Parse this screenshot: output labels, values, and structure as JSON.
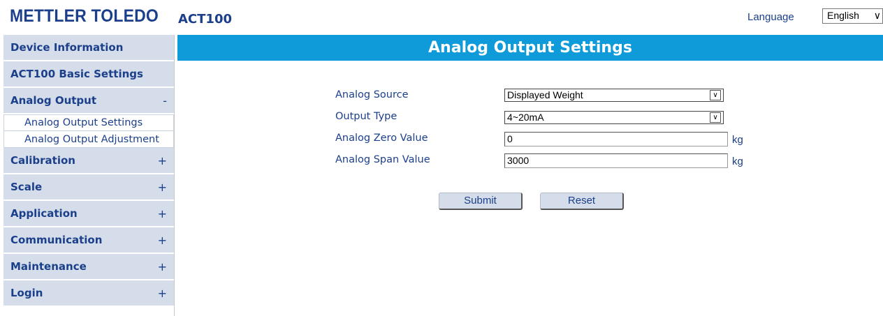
{
  "header": {
    "brand": "METTLER TOLEDO",
    "model": "ACT100",
    "language_label": "Language",
    "language_value": "English"
  },
  "sidebar": {
    "items": [
      {
        "label": "Device Information",
        "toggle": ""
      },
      {
        "label": "ACT100 Basic Settings",
        "toggle": ""
      },
      {
        "label": "Analog Output",
        "toggle": "-"
      },
      {
        "label": "Calibration",
        "toggle": "+"
      },
      {
        "label": "Scale",
        "toggle": "+"
      },
      {
        "label": "Application",
        "toggle": "+"
      },
      {
        "label": "Communication",
        "toggle": "+"
      },
      {
        "label": "Maintenance",
        "toggle": "+"
      },
      {
        "label": "Login",
        "toggle": "+"
      }
    ],
    "analog_output_subitems": [
      {
        "label": "Analog Output Settings"
      },
      {
        "label": "Analog Output Adjustment"
      }
    ]
  },
  "page": {
    "title": "Analog Output Settings"
  },
  "form": {
    "analog_source": {
      "label": "Analog Source",
      "value": "Displayed Weight"
    },
    "output_type": {
      "label": "Output Type",
      "value": "4~20mA"
    },
    "zero_value": {
      "label": "Analog Zero Value",
      "value": "0",
      "unit": "kg"
    },
    "span_value": {
      "label": "Analog Span Value",
      "value": "3000",
      "unit": "kg"
    },
    "submit_label": "Submit",
    "reset_label": "Reset"
  },
  "colors": {
    "brand_blue": "#1b3f8b",
    "banner_blue": "#0f9ad9",
    "nav_bg": "#d4dde9"
  }
}
